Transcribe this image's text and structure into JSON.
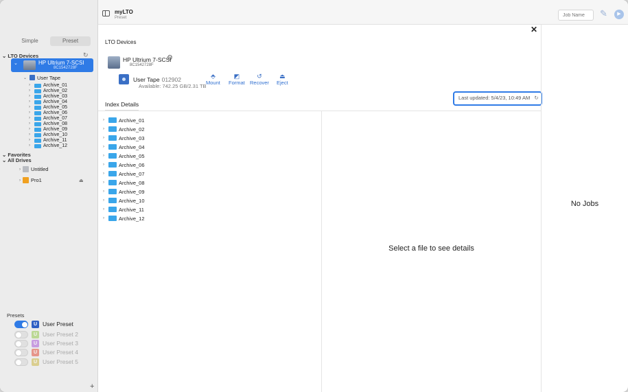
{
  "app": {
    "title": "myLTO",
    "subtitle": "Preset"
  },
  "sidebar": {
    "tabs": [
      {
        "label": "Simple"
      },
      {
        "label": "Preset"
      }
    ],
    "lto_devices_label": "LTO Devices",
    "device": {
      "name": "HP Ultrium 7-SCSI",
      "serial": "8C1542728F"
    },
    "tape": {
      "label": "User Tape"
    },
    "archives": [
      "Archive_01",
      "Archive_02",
      "Archive_03",
      "Archive_04",
      "Archive_05",
      "Archive_06",
      "Archive_07",
      "Archive_08",
      "Archive_09",
      "Archive_10",
      "Archive_11",
      "Archive_12"
    ],
    "favorites_label": "Favorites",
    "all_drives_label": "All Drives",
    "drives": [
      {
        "name": "Untitled"
      },
      {
        "name": "Pro1"
      }
    ],
    "presets_label": "Presets",
    "presets": [
      {
        "label": "User Preset",
        "badge": "U",
        "enabled": true,
        "color": "#2f5fc4"
      },
      {
        "label": "User Preset 2",
        "badge": "U",
        "enabled": false,
        "color": "#8bc53f"
      },
      {
        "label": "User Preset 3",
        "badge": "U",
        "enabled": false,
        "color": "#a34fd6"
      },
      {
        "label": "User Preset 4",
        "badge": "U",
        "enabled": false,
        "color": "#e2412a"
      },
      {
        "label": "User Preset 5",
        "badge": "U",
        "enabled": false,
        "color": "#c9b235"
      }
    ],
    "add_label": "+"
  },
  "toolbar": {
    "job_name_placeholder": "Job Name"
  },
  "main": {
    "lto_devices_title": "LTO Devices",
    "drive": {
      "name": "HP Ultrium 7-SCSI",
      "serial": "8C1542728F"
    },
    "tape": {
      "label": "User Tape",
      "code": "012902",
      "available": "Available: 742.25 GB/2.31 TB"
    },
    "actions": [
      {
        "label": "Mount"
      },
      {
        "label": "Format"
      },
      {
        "label": "Recover"
      },
      {
        "label": "Eject"
      }
    ],
    "last_updated": "Last updated: 5/4/23, 10:49 AM",
    "index_title": "Index Details",
    "archives": [
      "Archive_01",
      "Archive_02",
      "Archive_03",
      "Archive_04",
      "Archive_05",
      "Archive_06",
      "Archive_07",
      "Archive_08",
      "Archive_09",
      "Archive_10",
      "Archive_11",
      "Archive_12"
    ],
    "select_message": "Select a file to see details",
    "no_jobs": "No Jobs"
  },
  "colors": {
    "accent": "#2f7be6",
    "folder": "#3aa6ea"
  }
}
